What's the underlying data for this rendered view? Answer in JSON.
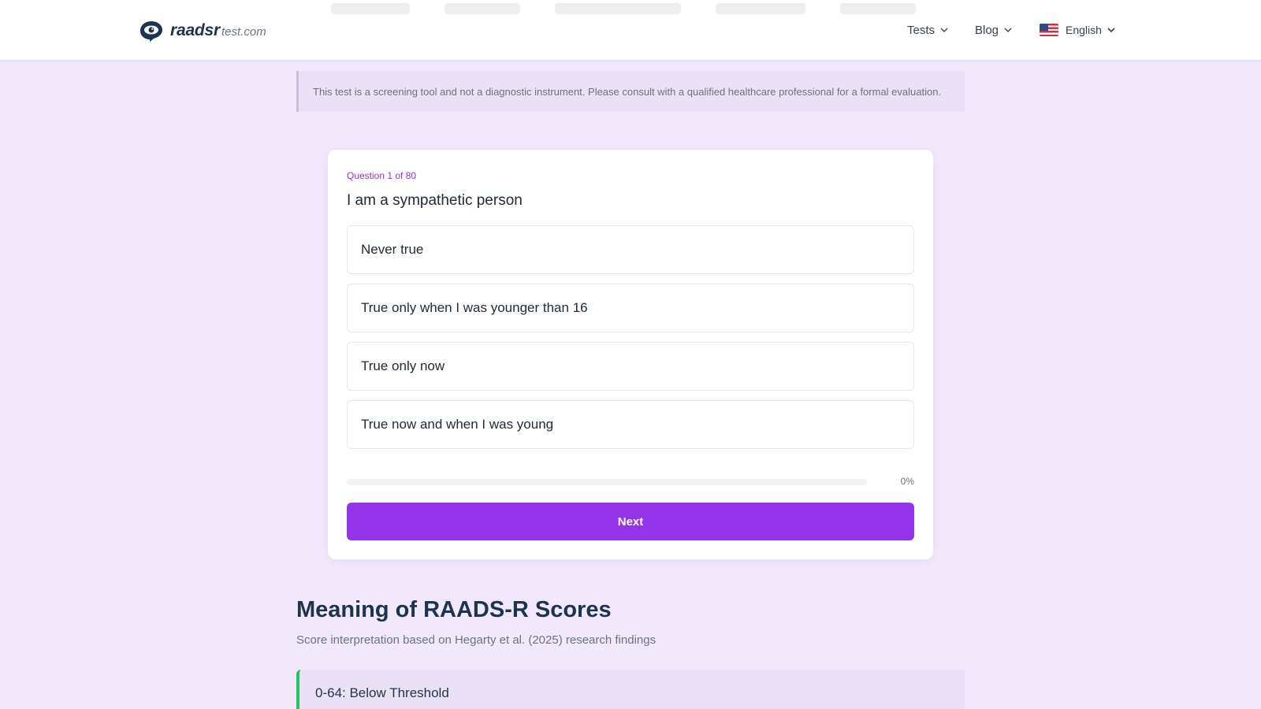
{
  "header": {
    "brand": "raadsr",
    "domain": "test.com",
    "nav": {
      "tests_label": "Tests",
      "blog_label": "Blog",
      "language_label": "English"
    }
  },
  "disclaimer": "This test is a screening tool and not a diagnostic instrument. Please consult with a qualified healthcare professional for a formal evaluation.",
  "quiz": {
    "counter": "Question 1 of 80",
    "question": "I am a sympathetic person",
    "options": [
      "Never true",
      "True only when I was younger than 16",
      "True only now",
      "True now and when I was young"
    ],
    "progress_value": 0,
    "progress_label": "0%",
    "next_label": "Next"
  },
  "meaning": {
    "title": "Meaning of RAADS-R Scores",
    "subtitle": "Score interpretation based on Hegarty et al. (2025) research findings",
    "ranges": [
      {
        "label": "0-64: Below Threshold"
      }
    ]
  },
  "colors": {
    "accent": "#9333ea",
    "background": "#f2e8fc",
    "brand_dark": "#1b3550",
    "range_ok": "#22c55e"
  },
  "icons": {
    "logo": "brain-eye-icon",
    "dropdown": "chevron-down-icon",
    "flag": "us-flag-icon"
  }
}
